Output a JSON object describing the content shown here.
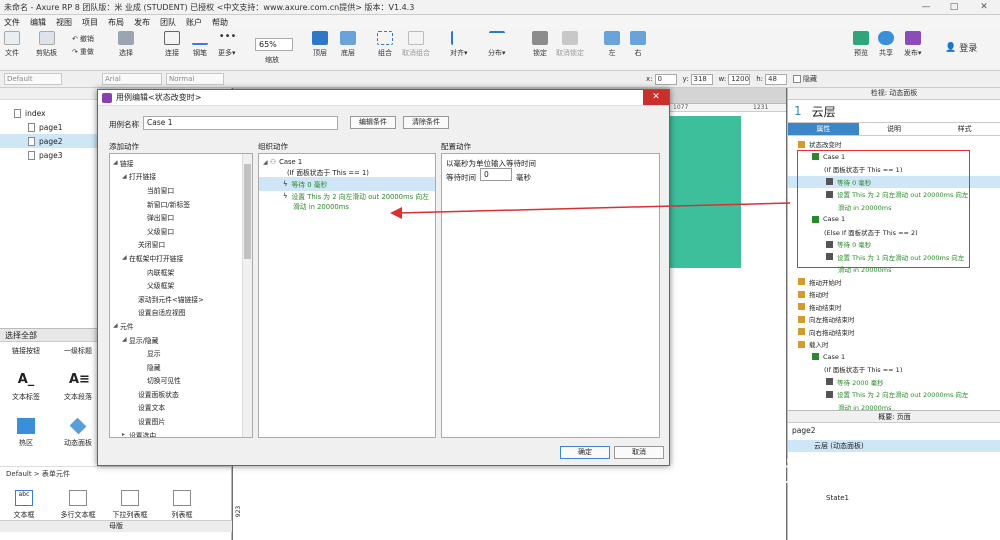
{
  "window": {
    "title": "未命名 - Axure RP 8 团队版：米 业成 (STUDENT) 已授权     <中文支持：www.axure.com.cn提供> 版本：V1.4.3"
  },
  "menu": [
    "文件",
    "编辑",
    "视图",
    "项目",
    "布局",
    "发布",
    "团队",
    "账户",
    "帮助"
  ],
  "toolbar": {
    "file": "文件",
    "clipboard": "剪贴板",
    "undo": "撤销",
    "redo": "重做",
    "select": "选择",
    "connect": "连接",
    "pen": "钢笔",
    "more": "更多▾",
    "zoom": "65%",
    "zoom_label": "缩放",
    "top": "顶层",
    "bottom": "底层",
    "group": "组合",
    "ungroup": "取消组合",
    "align": "对齐▾",
    "distribute": "分布▾",
    "lock": "锁定",
    "unlock": "取消锁定",
    "left": "左",
    "right": "右",
    "preview": "预览",
    "share": "共享",
    "publish": "发布▾",
    "login": "登录"
  },
  "formatbar": {
    "style": "Default",
    "font": "Arial",
    "weight": "Normal",
    "x": "0",
    "y": "318",
    "w": "1200",
    "h": "48",
    "hide": "隐藏"
  },
  "pages": [
    "index",
    "page1",
    "page2",
    "page3"
  ],
  "library": {
    "header": "选择全部",
    "top_items": [
      "链接按钮",
      "一级标题"
    ],
    "items": [
      "文本标签",
      "文本段落",
      "热区",
      "动态面板"
    ],
    "default_header": "Default > 表单元件",
    "form_items": [
      "文本框",
      "多行文本框",
      "下拉列表框",
      "列表框"
    ],
    "footer": "母版"
  },
  "canvas": {
    "ruler_a": "1077",
    "ruler_b": "1231",
    "corner": "923"
  },
  "dialog": {
    "title": "用例编辑<状态改变时>",
    "case_name_label": "用例名称",
    "case_name": "Case 1",
    "edit_condition": "编辑条件",
    "clear_condition": "清除条件",
    "add_action": "添加动作",
    "organize_action": "组织动作",
    "config_action": "配置动作",
    "actions": [
      {
        "text": "链接",
        "lvl": 0,
        "ex": "◢"
      },
      {
        "text": "打开链接",
        "lvl": 1,
        "ex": "◢"
      },
      {
        "text": "当前窗口",
        "lvl": 3,
        "ex": ""
      },
      {
        "text": "新窗口/新标签",
        "lvl": 3,
        "ex": ""
      },
      {
        "text": "弹出窗口",
        "lvl": 3,
        "ex": ""
      },
      {
        "text": "父级窗口",
        "lvl": 3,
        "ex": ""
      },
      {
        "text": "关闭窗口",
        "lvl": 2,
        "ex": ""
      },
      {
        "text": "在框架中打开链接",
        "lvl": 1,
        "ex": "◢"
      },
      {
        "text": "内联框架",
        "lvl": 3,
        "ex": ""
      },
      {
        "text": "父级框架",
        "lvl": 3,
        "ex": ""
      },
      {
        "text": "滚动到元件<锚链接>",
        "lvl": 2,
        "ex": ""
      },
      {
        "text": "设置自适应视图",
        "lvl": 2,
        "ex": ""
      },
      {
        "text": "元件",
        "lvl": 0,
        "ex": "◢"
      },
      {
        "text": "显示/隐藏",
        "lvl": 1,
        "ex": "◢"
      },
      {
        "text": "显示",
        "lvl": 3,
        "ex": ""
      },
      {
        "text": "隐藏",
        "lvl": 3,
        "ex": ""
      },
      {
        "text": "切换可见性",
        "lvl": 3,
        "ex": ""
      },
      {
        "text": "设置面板状态",
        "lvl": 2,
        "ex": ""
      },
      {
        "text": "设置文本",
        "lvl": 2,
        "ex": ""
      },
      {
        "text": "设置图片",
        "lvl": 2,
        "ex": ""
      },
      {
        "text": "设置选中",
        "lvl": 1,
        "ex": "▸"
      }
    ],
    "org": {
      "case": "Case 1",
      "cond": "(If 面板状态于 This == 1)",
      "wait": "等待 0 毫秒",
      "set1": "设置 This 为 2 向左滑动 out 20000ms 向左",
      "set2": "滑动 in 20000ms"
    },
    "config_desc": "以毫秒为单位输入等待时间",
    "wait_label": "等待时间",
    "wait_value": "0",
    "wait_unit": "毫秒",
    "ok": "确定",
    "cancel": "取消"
  },
  "right": {
    "head": "检视: 动态面板",
    "num": "1",
    "name": "云层",
    "tabs": [
      "属性",
      "说明",
      "样式"
    ],
    "events": [
      {
        "t": "状态改变时",
        "lvl": 0,
        "k": "ev"
      },
      {
        "t": "Case 1",
        "lvl": 1,
        "k": "case"
      },
      {
        "t": "(If 面板状态于 This == 1)",
        "lvl": 1,
        "k": "cond"
      },
      {
        "t": "等待 0 毫秒",
        "lvl": 2,
        "k": "act",
        "sel": true
      },
      {
        "t": "设置 This 为 2 向左滑动 out 20000ms 向左",
        "lvl": 2,
        "k": "set"
      },
      {
        "t": "滑动 in 20000ms",
        "lvl": 2,
        "k": "cont"
      },
      {
        "t": "Case 1",
        "lvl": 1,
        "k": "case"
      },
      {
        "t": "(Else If 面板状态于 This == 2)",
        "lvl": 1,
        "k": "cond"
      },
      {
        "t": "等待 0 毫秒",
        "lvl": 2,
        "k": "act"
      },
      {
        "t": "设置 This 为 1 向左滑动 out 2000ms 向左",
        "lvl": 2,
        "k": "set"
      },
      {
        "t": "滑动 in 20000ms",
        "lvl": 2,
        "k": "cont"
      },
      {
        "t": "拖动开始时",
        "lvl": 0,
        "k": "ev"
      },
      {
        "t": "拖动时",
        "lvl": 0,
        "k": "ev"
      },
      {
        "t": "拖动结束时",
        "lvl": 0,
        "k": "ev"
      },
      {
        "t": "向左拖动结束时",
        "lvl": 0,
        "k": "ev"
      },
      {
        "t": "向右拖动结束时",
        "lvl": 0,
        "k": "ev"
      },
      {
        "t": "载入时",
        "lvl": 0,
        "k": "ev"
      },
      {
        "t": "Case 1",
        "lvl": 1,
        "k": "case"
      },
      {
        "t": "(If 面板状态于 This == 1)",
        "lvl": 1,
        "k": "cond"
      },
      {
        "t": "等待 2000 毫秒",
        "lvl": 2,
        "k": "act"
      },
      {
        "t": "设置 This 为 2 向左滑动 out 20000ms 向左",
        "lvl": 2,
        "k": "set"
      },
      {
        "t": "滑动 in 20000ms",
        "lvl": 2,
        "k": "cont"
      }
    ],
    "outline_head": "概要: 页面",
    "outline_page": "page2",
    "outline_item": "云层 (动态面板)",
    "outline_state": "State1"
  },
  "colors": {
    "accent": "#3b86c6",
    "teal": "#3dbf9c",
    "arrow": "#d93030"
  }
}
